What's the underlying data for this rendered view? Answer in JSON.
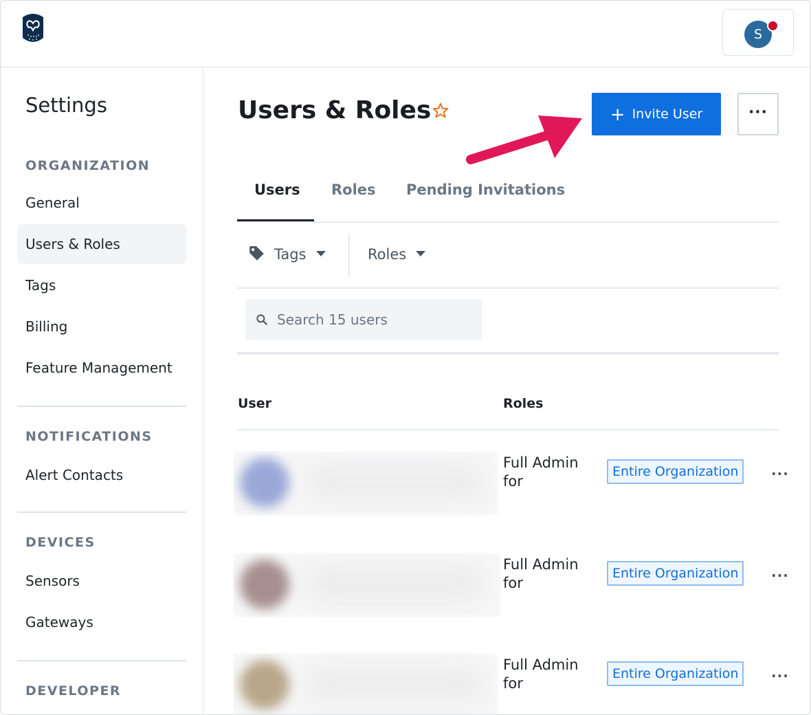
{
  "header": {
    "logo_icon": "owl-logo-icon",
    "avatar_initial": "S",
    "notification_color": "#c8102e"
  },
  "sidebar": {
    "title": "Settings",
    "sections": [
      {
        "heading": "ORGANIZATION",
        "items": [
          "General",
          "Users & Roles",
          "Tags",
          "Billing",
          "Feature Management"
        ]
      },
      {
        "heading": "NOTIFICATIONS",
        "items": [
          "Alert Contacts"
        ]
      },
      {
        "heading": "DEVICES",
        "items": [
          "Sensors",
          "Gateways"
        ]
      },
      {
        "heading": "DEVELOPER",
        "items": []
      }
    ],
    "active_item": "Users & Roles"
  },
  "main": {
    "title": "Users & Roles",
    "favorite_icon": "star-outline-icon",
    "invite_label": "Invite User",
    "more_icon": "ellipsis-icon",
    "tabs": [
      "Users",
      "Roles",
      "Pending Invitations"
    ],
    "active_tab": "Users",
    "filters": {
      "tags_label": "Tags",
      "roles_label": "Roles"
    },
    "search_placeholder": "Search 15 users",
    "columns": {
      "user": "User",
      "roles": "Roles"
    },
    "rows": [
      {
        "role": "Full Admin for",
        "scope": "Entire Organization",
        "avatar_color": "#9aa8d8"
      },
      {
        "role": "Full Admin for",
        "scope": "Entire Organization",
        "avatar_color": "#a88f8f"
      },
      {
        "role": "Full Admin for",
        "scope": "Entire Organization",
        "avatar_color": "#b8a78a"
      }
    ]
  },
  "colors": {
    "accent": "#0f6fde",
    "annotation_arrow": "#e0185a",
    "star": "#e8711a"
  }
}
